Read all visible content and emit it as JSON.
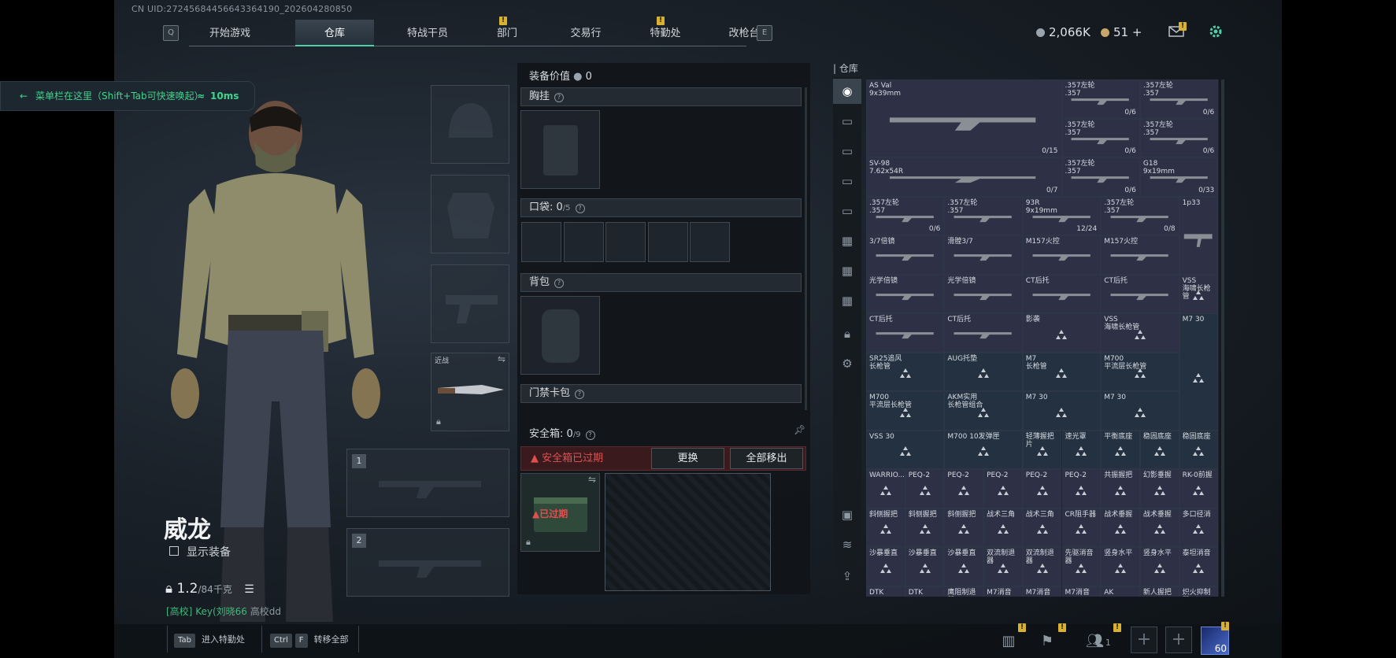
{
  "header": {
    "uid": "CN UID:2724568445664336419­0_202604280850",
    "q_key": "Q",
    "e_key": "E",
    "tabs": [
      {
        "label": "开始游戏"
      },
      {
        "label": "仓库",
        "active": true
      },
      {
        "label": "特战干员"
      },
      {
        "label": "部门",
        "alert": true
      },
      {
        "label": "交易行"
      },
      {
        "label": "特勤处",
        "alert": true
      },
      {
        "label": "改枪台"
      }
    ],
    "alert_mark": "!",
    "currency_hafcoin": "2,066K",
    "currency_bond": "51",
    "currency_add": "+"
  },
  "toast": {
    "text": "菜单栏在这里（Shift+Tab可快速唤起）",
    "ping": "10ms",
    "arrow": "←"
  },
  "character": {
    "name": "威龙",
    "show_gear_label": "显示装备",
    "weight": "1.2",
    "weight_max": "/84千克",
    "rank_tag": "[高校]",
    "rank_name": "Key(刘晓66",
    "rank_school": "高校dd"
  },
  "equipment": {
    "value_label": "装备价值",
    "value": "0",
    "chest_label": "胸挂",
    "pockets_label": "口袋:",
    "pockets_count": "0",
    "pockets_max": "/5",
    "backpack_label": "背包",
    "keycard_label": "门禁卡包",
    "melee_label": "近战",
    "slot1": "1",
    "slot2": "2",
    "safebox_label": "安全箱:",
    "safebox_count": "0",
    "safebox_max": "/9",
    "safebox_warning": "安全箱已过期",
    "safebox_expired_tag": "已过期",
    "replace_button": "更换",
    "move_all_button": "全部移出"
  },
  "warehouse": {
    "title": "仓库",
    "items": [
      {
        "name": "AS Val",
        "sub": "9x39mm",
        "count": "0/15"
      },
      {
        "name": ".357左轮",
        "sub": ".357",
        "count": "0/6"
      },
      {
        "name": ".357左轮",
        "sub": ".357",
        "count": "0/6"
      },
      {
        "name": ".357左轮",
        "sub": ".357",
        "count": "0/6"
      },
      {
        "name": ".357左轮",
        "sub": ".357",
        "count": "0/6"
      },
      {
        "name": "SV-98",
        "sub": "7.62x54R",
        "count": "0/7"
      },
      {
        "name": ".357左轮",
        "sub": ".357",
        "count": "0/6"
      },
      {
        "name": "G18",
        "sub": "9x19mm",
        "count": "0/33"
      },
      {
        "name": ".357左轮",
        "sub": ".357",
        "count": "0/6"
      },
      {
        "name": ".357左轮",
        "sub": ".357",
        "count": ""
      },
      {
        "name": "93R",
        "sub": "9x19mm",
        "count": "12/24"
      },
      {
        "name": ".357左轮",
        "sub": ".357",
        "count": "0/8"
      },
      {
        "name": "1p33",
        "sub": "",
        "count": ""
      },
      {
        "name": "3/7倍镜",
        "sub": "",
        "count": ""
      },
      {
        "name": "滑膛3/7",
        "sub": "",
        "count": ""
      },
      {
        "name": "M157火控",
        "sub": "",
        "count": ""
      },
      {
        "name": "M157火控",
        "sub": "",
        "count": ""
      },
      {
        "name": "光学倍镜",
        "sub": "",
        "count": ""
      },
      {
        "name": "光学倍镜",
        "sub": "",
        "count": ""
      },
      {
        "name": "CT后托",
        "sub": "",
        "count": ""
      },
      {
        "name": "CT后托",
        "sub": "",
        "count": ""
      },
      {
        "name": "VSS",
        "sub": "海啸长枪管",
        "count": ""
      },
      {
        "name": "CT后托",
        "sub": "",
        "count": ""
      },
      {
        "name": "CT后托",
        "sub": "",
        "count": ""
      },
      {
        "name": "影袭",
        "sub": "",
        "count": ""
      },
      {
        "name": "VSS",
        "sub": "海啸长枪管",
        "count": ""
      },
      {
        "name": "SR25追风",
        "sub": "长枪管",
        "count": ""
      },
      {
        "name": "AUG托垫",
        "sub": "",
        "count": ""
      },
      {
        "name": "M7",
        "sub": "长枪管",
        "count": ""
      },
      {
        "name": "M700",
        "sub": "平流层长枪管",
        "count": ""
      },
      {
        "name": "M7 30",
        "sub": "",
        "count": ""
      },
      {
        "name": "M700",
        "sub": "平流层长枪管",
        "count": ""
      },
      {
        "name": "AKM实用",
        "sub": "长枪管组合",
        "count": ""
      },
      {
        "name": "M7 30",
        "sub": "",
        "count": ""
      },
      {
        "name": "M7 30",
        "sub": "",
        "count": ""
      },
      {
        "name": "VSS 30",
        "sub": "",
        "count": ""
      },
      {
        "name": "M700 10发弹匣",
        "sub": "",
        "count": ""
      },
      {
        "name": "轻薄握把片",
        "sub": "",
        "count": ""
      },
      {
        "name": "速光罩",
        "sub": "",
        "count": ""
      },
      {
        "name": "平衡底座",
        "sub": "",
        "count": ""
      },
      {
        "name": "稳固底座",
        "sub": "",
        "count": ""
      },
      {
        "name": "稳固底座",
        "sub": "",
        "count": ""
      },
      {
        "name": "WARRIO...",
        "sub": "",
        "count": ""
      },
      {
        "name": "PEQ-2",
        "sub": "",
        "count": ""
      },
      {
        "name": "PEQ-2",
        "sub": "",
        "count": ""
      },
      {
        "name": "PEQ-2",
        "sub": "",
        "count": ""
      },
      {
        "name": "PEQ-2",
        "sub": "",
        "count": ""
      },
      {
        "name": "PEQ-2",
        "sub": "",
        "count": ""
      },
      {
        "name": "共振握把",
        "sub": "",
        "count": ""
      },
      {
        "name": "幻影垂握",
        "sub": "",
        "count": ""
      },
      {
        "name": "RK-0前握",
        "sub": "",
        "count": ""
      },
      {
        "name": "斜侧握把",
        "sub": "",
        "count": ""
      },
      {
        "name": "斜侧握把",
        "sub": "",
        "count": ""
      },
      {
        "name": "斜侧握把",
        "sub": "",
        "count": ""
      },
      {
        "name": "战术三角",
        "sub": "",
        "count": ""
      },
      {
        "name": "战术三角",
        "sub": "",
        "count": ""
      },
      {
        "name": "CR阻手器",
        "sub": "",
        "count": ""
      },
      {
        "name": "战术垂握",
        "sub": "",
        "count": ""
      },
      {
        "name": "战术垂握",
        "sub": "",
        "count": ""
      },
      {
        "name": "多口径消",
        "sub": "",
        "count": ""
      },
      {
        "name": "沙暴垂直",
        "sub": "",
        "count": ""
      },
      {
        "name": "沙暴垂直",
        "sub": "",
        "count": ""
      },
      {
        "name": "沙暴垂直",
        "sub": "",
        "count": ""
      },
      {
        "name": "双流制退器",
        "sub": "",
        "count": ""
      },
      {
        "name": "双流制退器",
        "sub": "",
        "count": ""
      },
      {
        "name": "先驱消音器",
        "sub": "",
        "count": ""
      },
      {
        "name": "竖身水平",
        "sub": "",
        "count": ""
      },
      {
        "name": "竖身水平",
        "sub": "",
        "count": ""
      },
      {
        "name": "泰坦消音",
        "sub": "",
        "count": ""
      },
      {
        "name": "DTK",
        "sub": "",
        "count": ""
      },
      {
        "name": "DTK",
        "sub": "",
        "count": ""
      },
      {
        "name": "鹰阻制退器",
        "sub": "",
        "count": ""
      },
      {
        "name": "M7消音",
        "sub": "",
        "count": ""
      },
      {
        "name": "M7消音",
        "sub": "",
        "count": ""
      },
      {
        "name": "M7消音",
        "sub": "",
        "count": ""
      },
      {
        "name": "AK",
        "sub": "",
        "count": ""
      },
      {
        "name": "新人握把",
        "sub": "",
        "count": ""
      },
      {
        "name": "炽火抑制器",
        "sub": "",
        "count": ""
      }
    ]
  },
  "bottom": {
    "tab_key": "Tab",
    "tab_hint": "进入特勤处",
    "ctrl_key": "Ctrl",
    "f_key": "F",
    "transfer_hint": "转移全部",
    "squad_count": "1",
    "level": "60"
  },
  "colors": {
    "accent_green": "#4fd1a8",
    "alert_yellow": "#d9b130",
    "expired_red": "#e05050",
    "cell_purple": "#2e3046",
    "cell_blue": "#243141"
  }
}
